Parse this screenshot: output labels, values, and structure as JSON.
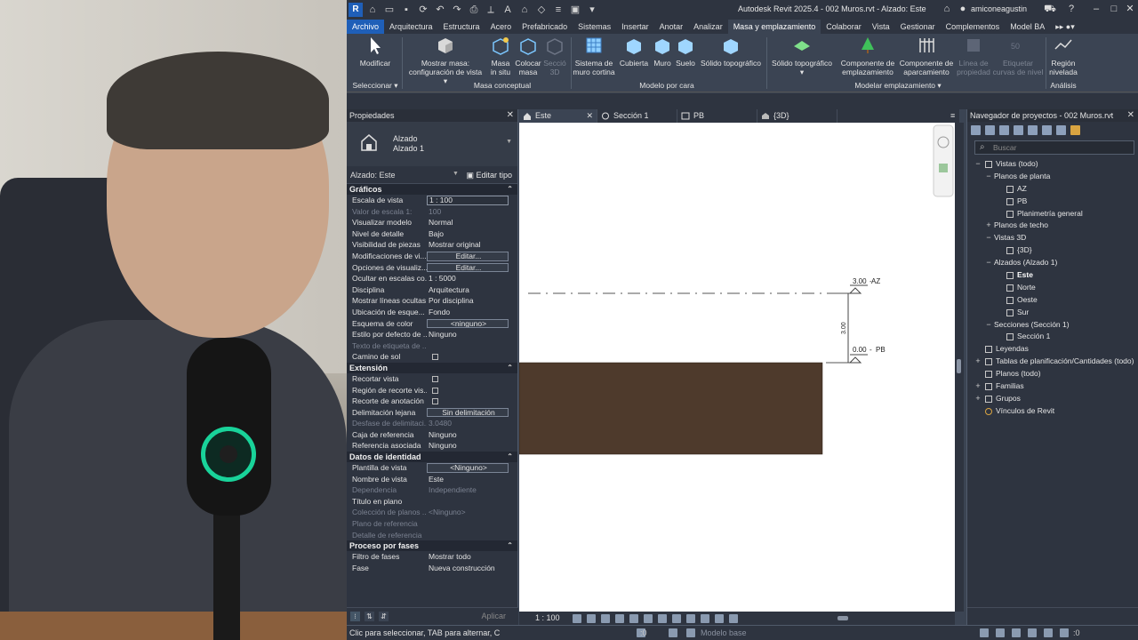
{
  "titlebar": {
    "document_title": "Autodesk Revit 2025.4 - 002 Muros.rvt - Alzado: Este",
    "user": "amiconeagustin",
    "app_logo": "R"
  },
  "menu": {
    "items": [
      "Archivo",
      "Arquitectura",
      "Estructura",
      "Acero",
      "Prefabricado",
      "Sistemas",
      "Insertar",
      "Anotar",
      "Analizar",
      "Masa y emplazamiento",
      "Colaborar",
      "Vista",
      "Gestionar",
      "Complementos",
      "Model BA"
    ]
  },
  "ribbon": {
    "modify_label": "Modificar",
    "select_label": "Seleccionar ▾",
    "buttons": [
      {
        "line1": "Mostrar masa:",
        "line2": "configuración de vista ▾"
      },
      {
        "line1": "Masa",
        "line2": "in situ"
      },
      {
        "line1": "Colocar",
        "line2": "masa"
      },
      {
        "line1": "Secció",
        "line2": "3D"
      },
      {
        "line1": "Sistema de",
        "line2": "muro cortina"
      },
      {
        "line1": "Cubierta",
        "line2": ""
      },
      {
        "line1": "Muro",
        "line2": ""
      },
      {
        "line1": "Suelo",
        "line2": ""
      },
      {
        "line1": "Sólido topográfico",
        "line2": ""
      },
      {
        "line1": "Sólido topográfico",
        "line2": "▾"
      },
      {
        "line1": "Componente de",
        "line2": "emplazamiento"
      },
      {
        "line1": "Componente de",
        "line2": "aparcamiento"
      },
      {
        "line1": "Línea de",
        "line2": "propiedad"
      },
      {
        "line1": "Etiquetar",
        "line2": "curvas de nivel"
      },
      {
        "line1": "Región",
        "line2": "nivelada"
      }
    ],
    "groups": [
      "Masa conceptual",
      "Modelo por cara",
      "Modelar emplazamiento ▾",
      "Análisis"
    ]
  },
  "properties": {
    "title": "Propiedades",
    "type_name": "Alzado",
    "type_sub": "Alzado 1",
    "instance_selector": "Alzado: Este",
    "edit_type": "Editar tipo",
    "apply": "Aplicar",
    "sections": [
      {
        "name": "Gráficos",
        "rows": [
          {
            "label": "Escala de vista",
            "value": "1 : 100",
            "kind": "field"
          },
          {
            "label": "Valor de escala    1:",
            "value": "100",
            "kind": "dis"
          },
          {
            "label": "Visualizar modelo",
            "value": "Normal"
          },
          {
            "label": "Nivel de detalle",
            "value": "Bajo"
          },
          {
            "label": "Visibilidad de piezas",
            "value": "Mostrar original"
          },
          {
            "label": "Modificaciones de vi...",
            "value": "Editar...",
            "kind": "box"
          },
          {
            "label": "Opciones de visualiz...",
            "value": "Editar...",
            "kind": "box"
          },
          {
            "label": "Ocultar en escalas co...",
            "value": "1 : 5000"
          },
          {
            "label": "Disciplina",
            "value": "Arquitectura"
          },
          {
            "label": "Mostrar líneas ocultas",
            "value": "Por disciplina"
          },
          {
            "label": "Ubicación de esque...",
            "value": "Fondo"
          },
          {
            "label": "Esquema de color",
            "value": "<ninguno>",
            "kind": "box"
          },
          {
            "label": "Estilo por defecto de ...",
            "value": "Ninguno"
          },
          {
            "label": "Texto de etiqueta de ...",
            "value": "",
            "kind": "dis"
          },
          {
            "label": "Camino de sol",
            "value": "",
            "kind": "check"
          }
        ]
      },
      {
        "name": "Extensión",
        "rows": [
          {
            "label": "Recortar vista",
            "value": "",
            "kind": "check"
          },
          {
            "label": "Región de recorte vis...",
            "value": "",
            "kind": "check"
          },
          {
            "label": "Recorte de anotación",
            "value": "",
            "kind": "check"
          },
          {
            "label": "Delimitación lejana",
            "value": "Sin delimitación",
            "kind": "box"
          },
          {
            "label": "Desfase de delimitaci...",
            "value": "3.0480",
            "kind": "dis"
          },
          {
            "label": "Caja de referencia",
            "value": "Ninguno"
          },
          {
            "label": "Referencia asociada",
            "value": "Ninguno"
          }
        ]
      },
      {
        "name": "Datos de identidad",
        "rows": [
          {
            "label": "Plantilla de vista",
            "value": "<Ninguno>",
            "kind": "box"
          },
          {
            "label": "Nombre de vista",
            "value": "Este"
          },
          {
            "label": "Dependencia",
            "value": "Independiente",
            "kind": "dis"
          },
          {
            "label": "Título en plano",
            "value": ""
          },
          {
            "label": "Colección de planos ...",
            "value": "<Ninguno>",
            "kind": "dis"
          },
          {
            "label": "Plano de referencia",
            "value": "",
            "kind": "dis"
          },
          {
            "label": "Detalle de referencia",
            "value": "",
            "kind": "dis"
          }
        ]
      },
      {
        "name": "Proceso por fases",
        "rows": [
          {
            "label": "Filtro de fases",
            "value": "Mostrar todo"
          },
          {
            "label": "Fase",
            "value": "Nueva construcción"
          }
        ]
      }
    ]
  },
  "view_tabs": [
    {
      "label": "Este",
      "active": true
    },
    {
      "label": "Sección 1",
      "active": false
    },
    {
      "label": "PB",
      "active": false
    },
    {
      "label": "{3D}",
      "active": false
    }
  ],
  "canvas": {
    "level_top": {
      "elevation": "3.00",
      "name": "AZ"
    },
    "level_bottom": {
      "elevation": "0.00",
      "name": "PB"
    },
    "dimension": "3.00",
    "wall_color": "#4e3a2c"
  },
  "view_bar": {
    "scale": "1 : 100"
  },
  "browser": {
    "title": "Navegador de proyectos - 002 Muros.rvt",
    "search_placeholder": "Buscar",
    "tree": [
      {
        "label": "Vistas (todo)",
        "level": 0,
        "exp": "−",
        "icon": true
      },
      {
        "label": "Planos de planta",
        "level": 1,
        "exp": "−"
      },
      {
        "label": "AZ",
        "level": 2,
        "icon": true
      },
      {
        "label": "PB",
        "level": 2,
        "icon": true
      },
      {
        "label": "Planimetría general",
        "level": 2,
        "icon": true
      },
      {
        "label": "Planos de techo",
        "level": 1,
        "exp": "+"
      },
      {
        "label": "Vistas 3D",
        "level": 1,
        "exp": "−"
      },
      {
        "label": "{3D}",
        "level": 2,
        "icon": true
      },
      {
        "label": "Alzados (Alzado 1)",
        "level": 1,
        "exp": "−"
      },
      {
        "label": "Este",
        "level": 2,
        "icon": true,
        "bold": true
      },
      {
        "label": "Norte",
        "level": 2,
        "icon": true
      },
      {
        "label": "Oeste",
        "level": 2,
        "icon": true
      },
      {
        "label": "Sur",
        "level": 2,
        "icon": true
      },
      {
        "label": "Secciones (Sección 1)",
        "level": 1,
        "exp": "−"
      },
      {
        "label": "Sección 1",
        "level": 2,
        "icon": true
      },
      {
        "label": "Leyendas",
        "level": 0,
        "icon": true
      },
      {
        "label": "Tablas de planificación/Cantidades (todo)",
        "level": 0,
        "exp": "+",
        "icon": true
      },
      {
        "label": "Planos (todo)",
        "level": 0,
        "icon": true
      },
      {
        "label": "Familias",
        "level": 0,
        "exp": "+",
        "icon": true
      },
      {
        "label": "Grupos",
        "level": 0,
        "exp": "+",
        "icon": true
      },
      {
        "label": "Vínculos de Revit",
        "level": 0,
        "icon": true,
        "link": true
      }
    ]
  },
  "status": {
    "text": "Clic para seleccionar, TAB para alternar, C",
    "workset": ":0",
    "model": "Modelo base",
    "filter": ":0"
  }
}
